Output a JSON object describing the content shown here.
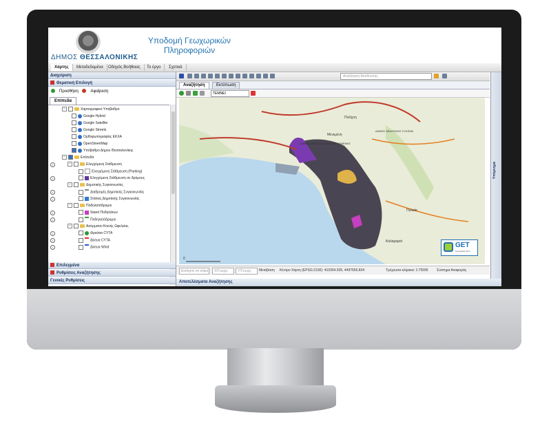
{
  "header": {
    "title_line1": "Υποδομή Γεωχωρικών",
    "title_line2": "Πληροφοριών",
    "municipality_prefix": "ΔΗΜΟΣ",
    "municipality_name": "ΘΕΣΣΑΛΟΝΙΚΗΣ"
  },
  "menu": [
    {
      "label": "Χάρτης",
      "active": true
    },
    {
      "label": "Μεταδεδομένα"
    },
    {
      "label": "Οδηγός Βοήθειας"
    },
    {
      "label": "Το έργο"
    },
    {
      "label": "Σχετικά"
    }
  ],
  "left_panel": {
    "manage_label": "Διαχείριση",
    "thematic_label": "Θεματική Επιλογή",
    "add_label": "Προσθήκη",
    "remove_label": "Αφαίρεση",
    "layers_tab": "Επίπεδα",
    "tree": [
      {
        "label": "Χαρτογραφικό Υπόβαθρο",
        "kind": "folder"
      },
      {
        "label": "Google Hybrid",
        "kind": "globe"
      },
      {
        "label": "Google Satellite",
        "kind": "globe"
      },
      {
        "label": "Google Streets",
        "kind": "globe"
      },
      {
        "label": "Ορθοφωτογραφίες ΕΚΧΑ",
        "kind": "globe"
      },
      {
        "label": "OpenStreetMap",
        "kind": "globe"
      },
      {
        "label": "Υπόβαθρο Δήμου Θεσσαλονίκης",
        "kind": "globe",
        "checked": true
      },
      {
        "label": "Επίπεδα",
        "kind": "folder",
        "checked": true
      },
      {
        "label": "Ελεγχόμενη Στάθμευση",
        "kind": "folder"
      },
      {
        "label": "Ελεγχόμενη Στάθμευση (Parking)",
        "kind": "item"
      },
      {
        "label": "Ελεγχόμενη Στάθμευση σε δρόμους",
        "kind": "item"
      },
      {
        "label": "Δημοτικής Συγκοινωνίας",
        "kind": "folder"
      },
      {
        "label": "Διαδρομές Δημοτικής Συγκοινωνίας",
        "kind": "item"
      },
      {
        "label": "Στάσεις Δημοτικής Συγκοινωνίας",
        "kind": "item"
      },
      {
        "label": "Ποδηλατόδρομοι",
        "kind": "folder"
      },
      {
        "label": "Stand Ποδηλάτων",
        "kind": "item"
      },
      {
        "label": "Ποδηλατόδρομοι",
        "kind": "item"
      },
      {
        "label": "Ασύρματοι Κοινής Ωφελείας",
        "kind": "folder"
      },
      {
        "label": "Φρεάτια CYTA",
        "kind": "item"
      },
      {
        "label": "Δίκτυα CYTA",
        "kind": "item"
      },
      {
        "label": "Δίκτυα Wind",
        "kind": "item"
      }
    ],
    "section_selected": "Επιλεγμένα",
    "section_search_settings": "Ρυθμίσεις Αναζήτησης",
    "section_general_settings": "Γενικές Ρυθμίσεις"
  },
  "map_panel": {
    "search_placeholder": "Αναζήτηση διεύθυνσης",
    "tab_search": "Αναζήτηση",
    "tab_print": "Εκτύπωση",
    "layer_select": "ΤΕΜΝΕΙ",
    "map_labels": {
      "meteora": "Μενεμένη",
      "polichni": "Πολίχνη",
      "neapoli": "ΔΗΜΟΣ ΝΕΑΠΟΛΗΣ ΣΥΚΕΩΝ",
      "ampelokipoi": "ΔΗΜΟΣ ΑΜΠΕΛΟΚΗΠΩΝ ΜΕΝΕΜΕΝΗΣ",
      "pylaia": "Πυλαία",
      "kalamaria": "Καλαμαριά"
    },
    "logo_text": "GET",
    "logo_sub": "Geospatial Tech",
    "scale_label": "0"
  },
  "statusbar": {
    "field1": "Εισάγετε σε κλίμα",
    "field2": "X/Γεωγρ.",
    "field3": "Y/Γεωγρ.",
    "measure": "Μετάβαση",
    "center": "Κέντρο Χάρτη (EPSG:2100): 410354.935, 4497556.834",
    "scale": "Τρέχουσα κλίμακα: 1:75595",
    "system": "Σύστημα Αναφοράς"
  },
  "results_title": "Αποτελέσματα Αναζήτησης",
  "right_panel_label": "Υπόμνημα",
  "colors": {
    "brand_blue": "#2474b0",
    "header_bg": "#cdd8e6",
    "sea": "#b9d8ee",
    "land": "#e9ecd8"
  }
}
